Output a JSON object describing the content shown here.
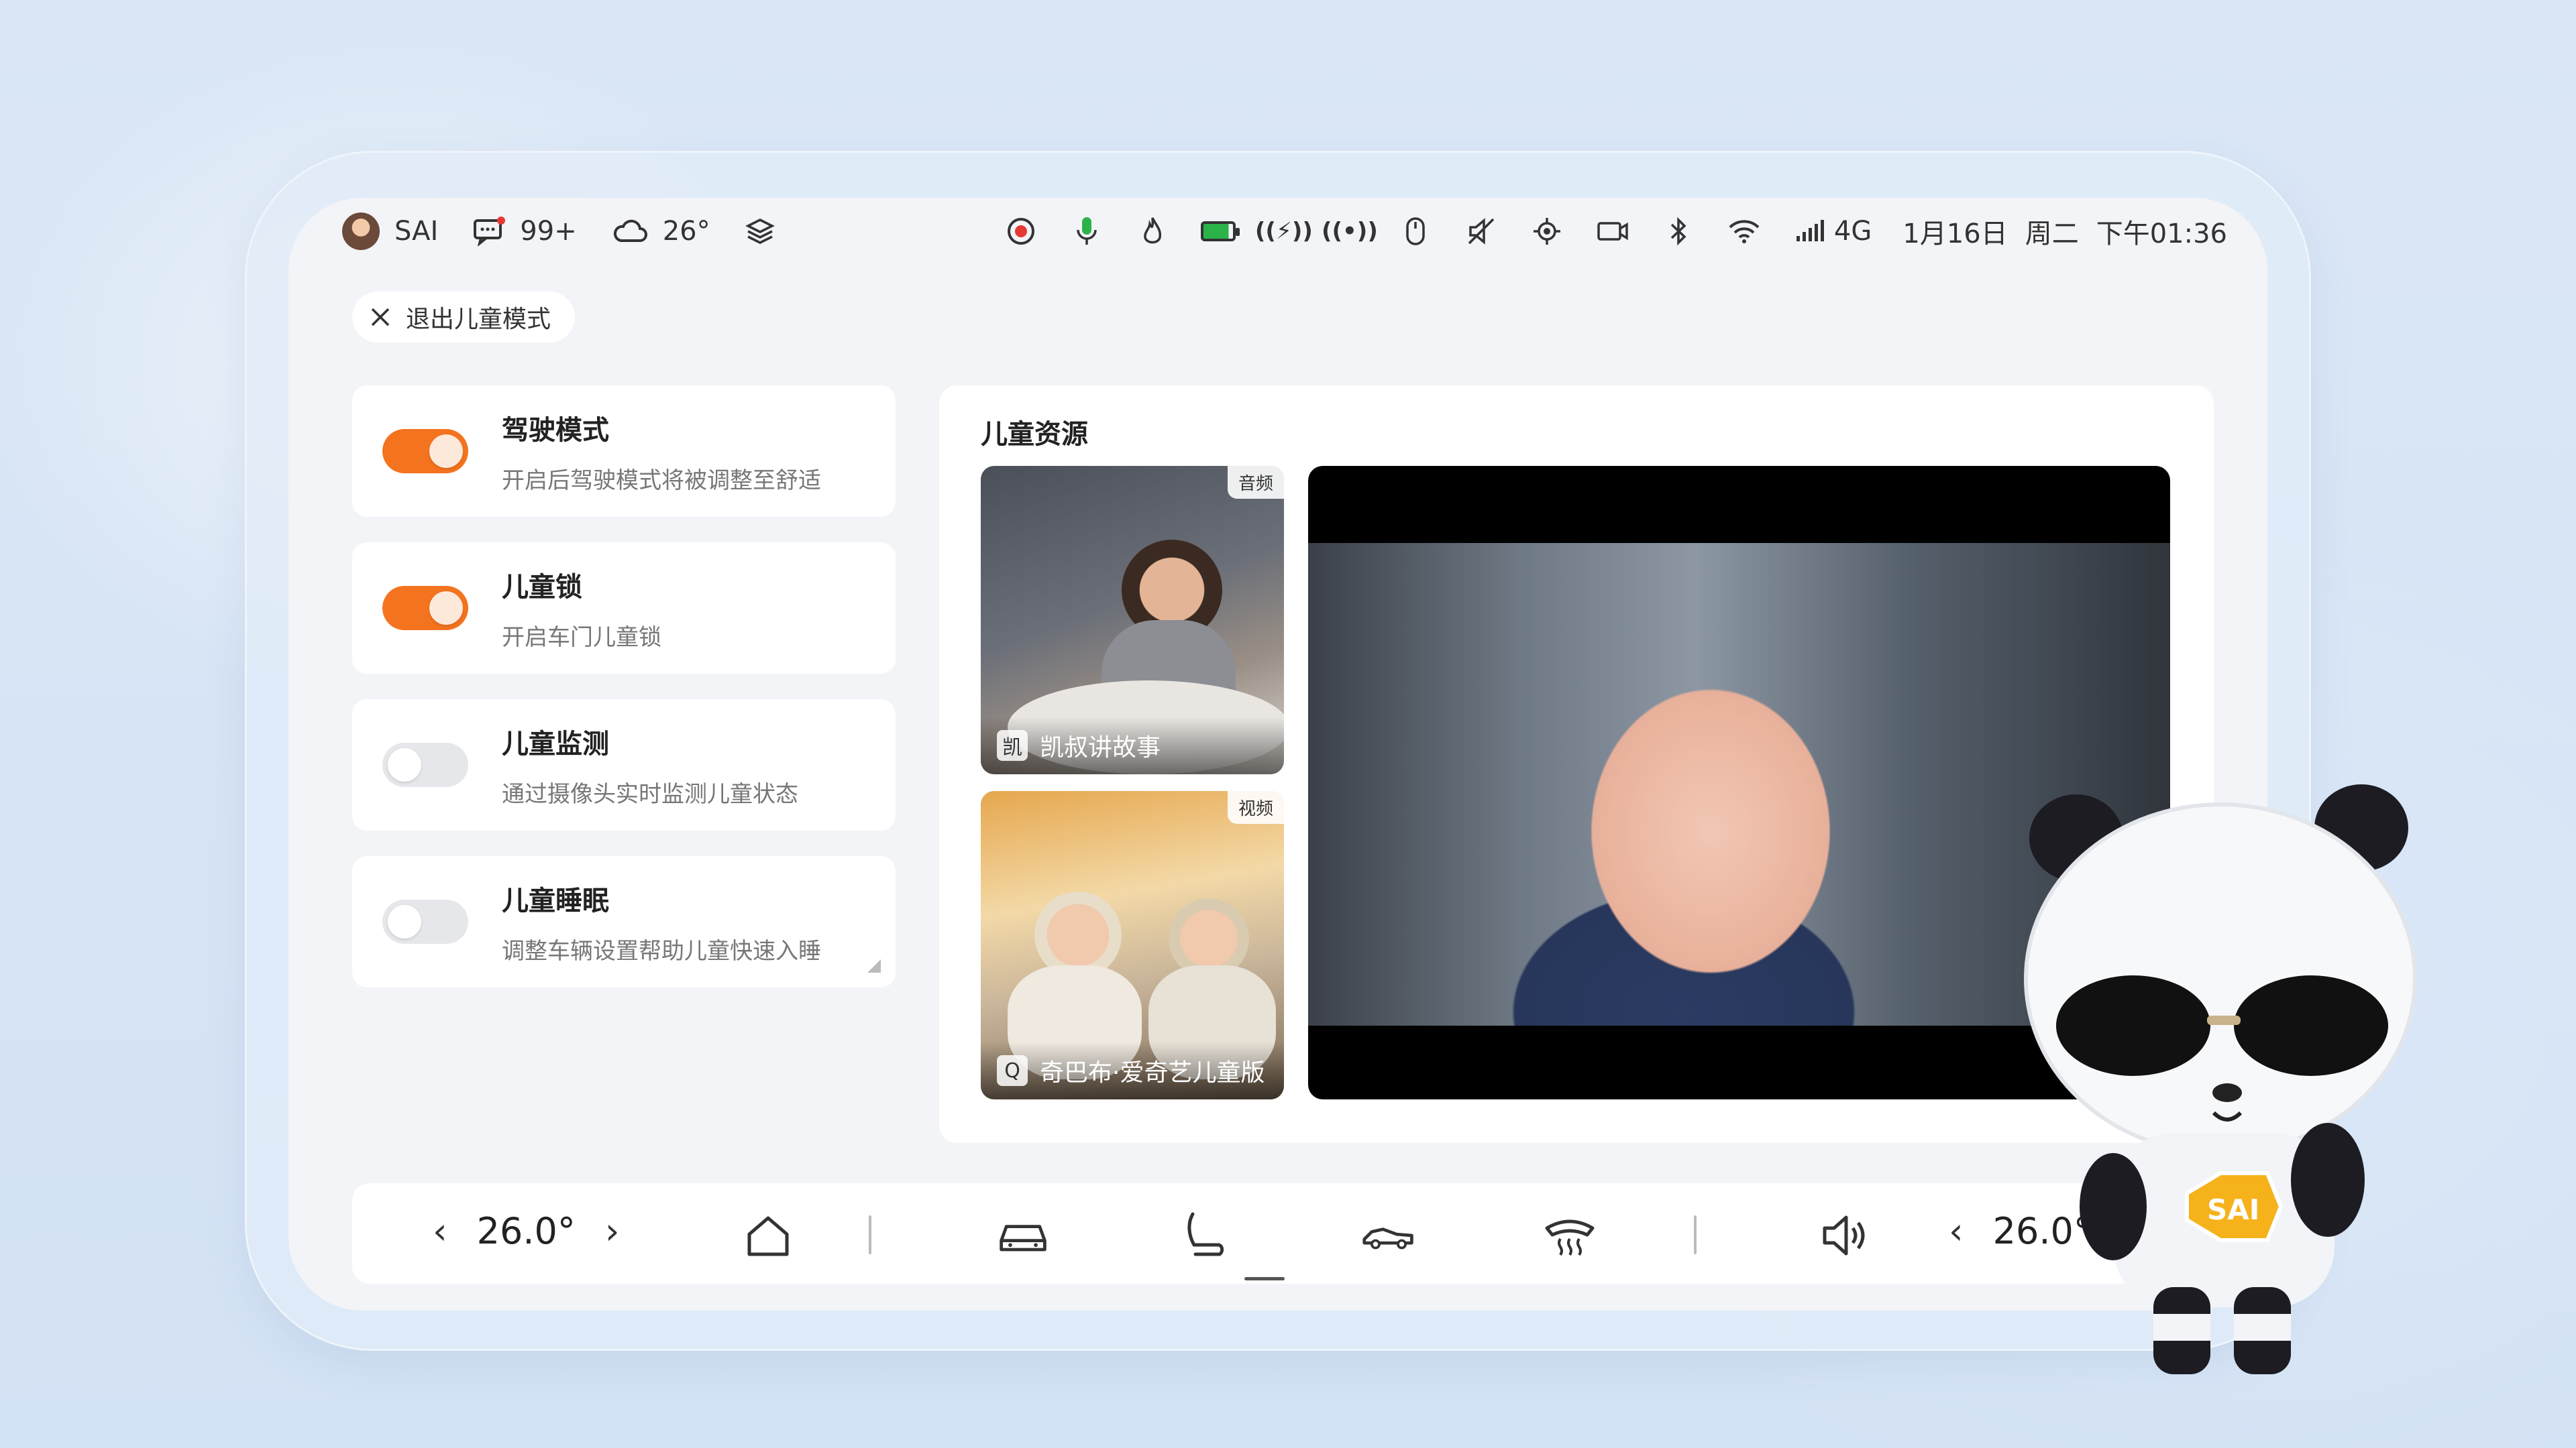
{
  "status_bar": {
    "user": "SAI",
    "messages": "99+",
    "weather_temp": "26°",
    "network": "4G",
    "date": "1月16日",
    "weekday": "周二",
    "time": "下午01:36",
    "icons": [
      "record-icon",
      "mic-icon",
      "flame-icon",
      "battery-icon",
      "hotspot-icon",
      "broadcast-icon",
      "mouse-icon",
      "mute-icon",
      "location-icon",
      "camera-icon",
      "bluetooth-icon",
      "wifi-icon",
      "signal-icon"
    ]
  },
  "exit_button": {
    "label": "退出儿童模式"
  },
  "toggles": [
    {
      "title": "驾驶模式",
      "desc": "开启后驾驶模式将被调整至舒适",
      "on": true
    },
    {
      "title": "儿童锁",
      "desc": "开启车门儿童锁",
      "on": true
    },
    {
      "title": "儿童监测",
      "desc": "通过摄像头实时监测儿童状态",
      "on": false
    },
    {
      "title": "儿童睡眠",
      "desc": "调整车辆设置帮助儿童快速入睡",
      "on": false
    }
  ],
  "resources": {
    "title": "儿童资源",
    "items": [
      {
        "tag": "音频",
        "logo": "凯",
        "caption": "凯叔讲故事"
      },
      {
        "tag": "视频",
        "logo": "Q",
        "caption": "奇巴布·爱奇艺儿童版"
      }
    ]
  },
  "dock": {
    "left_temp": "26.0°",
    "right_temp": "26.0°",
    "icons": [
      "home-icon",
      "car-icon",
      "seat-icon",
      "car-side-icon",
      "defrost-icon",
      "volume-icon"
    ]
  },
  "mascot": {
    "badge": "SAI"
  },
  "colors": {
    "accent": "#f4731f",
    "background": "#f3f4f7"
  }
}
